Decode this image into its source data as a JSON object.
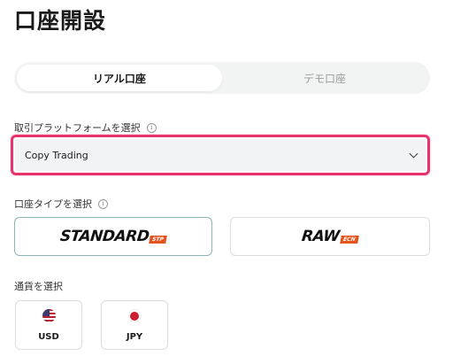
{
  "page": {
    "title": "口座開設"
  },
  "account_mode": {
    "tabs": [
      {
        "label": "リアル口座",
        "active": true
      },
      {
        "label": "デモ口座",
        "active": false
      }
    ]
  },
  "platform": {
    "label": "取引プラットフォームを選択",
    "info_glyph": "i",
    "selected_value": "Copy Trading",
    "highlight_color": "#e8336d"
  },
  "account_type": {
    "label": "口座タイプを選択",
    "info_glyph": "i",
    "options": [
      {
        "name": "STANDARD",
        "tag": "STP",
        "selected": true
      },
      {
        "name": "RAW",
        "tag": "ECN",
        "selected": false
      }
    ],
    "tag_color": "#e5541f"
  },
  "currency": {
    "label": "通貨を選択",
    "options": [
      {
        "code": "USD",
        "flag_icon": "us-flag-icon"
      },
      {
        "code": "JPY",
        "flag_icon": "jp-flag-icon"
      }
    ]
  }
}
